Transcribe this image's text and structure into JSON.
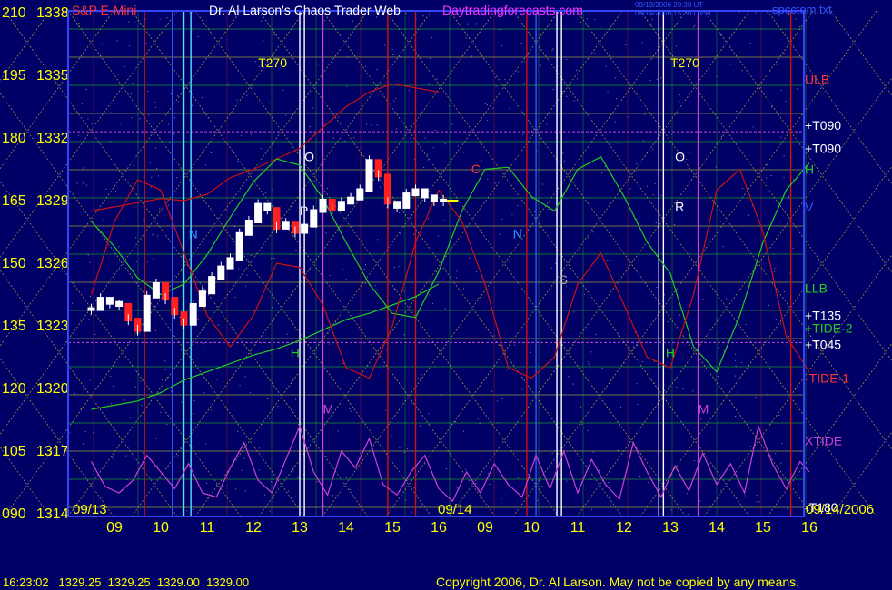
{
  "header": {
    "instrument": "S&P E-Mini",
    "title": "Dr. Al Larson's Chaos Trader Web",
    "site": "Daytradingforecasts.com",
    "stamp_line1": "09/13/2006 20:30 UT",
    "stamp_line2": "09/14/2006 15:30 Local",
    "filename": "spcctom.txt"
  },
  "footer": {
    "quote": "16:23:02   1329.25  1329.25  1329.00  1329.00",
    "copyright": "Copyright 2006, Dr. Al Larson. May not be copied by any means."
  },
  "colors": {
    "background": "#000066",
    "axis_text": "#ffff00",
    "price_bars": "#ffffff",
    "down_bars": "#ff2020",
    "green": "#22cc22",
    "red": "#cc1111",
    "magenta": "#cc44cc",
    "yellow_grid": "#cccc33"
  },
  "chart_data": {
    "type": "line",
    "title": "S&P E-Mini",
    "y_left_labels": [
      "210",
      "195",
      "180",
      "165",
      "150",
      "135",
      "120",
      "105",
      "090"
    ],
    "y_price_labels": [
      "1338",
      "1335",
      "1332",
      "1329",
      "1326",
      "1323",
      "1320",
      "1317",
      "1314"
    ],
    "ylim": [
      1314,
      1338
    ],
    "x_hour_labels": [
      "09",
      "10",
      "11",
      "12",
      "13",
      "14",
      "15",
      "16",
      "09",
      "10",
      "11",
      "12",
      "13",
      "14",
      "15",
      "16"
    ],
    "date_labels": [
      "09/13",
      "09/14",
      "09/14/2006"
    ],
    "right_labels": [
      {
        "text": "ULB",
        "color": "#ff3333",
        "price": 1334.8
      },
      {
        "text": "+T090",
        "color": "#ffffff",
        "price": 1332.6
      },
      {
        "text": "+T090",
        "color": "#ffffff",
        "price": 1331.5
      },
      {
        "text": "H",
        "color": "#22cc22",
        "price": 1330.5
      },
      {
        "text": "V",
        "color": "#3355ff",
        "price": 1328.7
      },
      {
        "text": "LLB",
        "color": "#22cc22",
        "price": 1324.8
      },
      {
        "text": "+T135",
        "color": "#ffffff",
        "price": 1323.5
      },
      {
        "text": "+TIDE-2",
        "color": "#22cc22",
        "price": 1322.9
      },
      {
        "text": "+T045",
        "color": "#ffffff",
        "price": 1322.1
      },
      {
        "text": "-TIDE-1",
        "color": "#ff3333",
        "price": 1320.5
      },
      {
        "text": "XTIDE",
        "color": "#cc44cc",
        "price": 1317.5
      },
      {
        "text": "-T180",
        "color": "#ffffff",
        "price": 1314.3
      }
    ],
    "cycle_labels": [
      {
        "text": "T270",
        "color": "#ffff00",
        "hour": 12.1,
        "price": 1335.4
      },
      {
        "text": "T270",
        "color": "#ffff00",
        "hour": 21.0,
        "price": 1335.4
      },
      {
        "text": "O",
        "color": "#ffffff",
        "hour": 13.1,
        "price": 1330.9
      },
      {
        "text": "O",
        "color": "#ffffff",
        "hour": 21.1,
        "price": 1330.9
      },
      {
        "text": "P",
        "color": "#ffffff",
        "hour": 13.0,
        "price": 1328.3
      },
      {
        "text": "R",
        "color": "#ffffff",
        "hour": 21.1,
        "price": 1328.5
      },
      {
        "text": "N",
        "color": "#3399ff",
        "hour": 10.6,
        "price": 1327.2
      },
      {
        "text": "N",
        "color": "#3399ff",
        "hour": 17.6,
        "price": 1327.2
      },
      {
        "text": "S",
        "color": "#aaaaaa",
        "hour": 18.6,
        "price": 1325.0
      },
      {
        "text": "H",
        "color": "#22cc22",
        "hour": 12.8,
        "price": 1321.5
      },
      {
        "text": "H",
        "color": "#22cc22",
        "hour": 20.9,
        "price": 1321.5
      },
      {
        "text": "M",
        "color": "#cc44cc",
        "hour": 13.5,
        "price": 1318.8
      },
      {
        "text": "M",
        "color": "#cc44cc",
        "hour": 21.6,
        "price": 1318.8
      },
      {
        "text": "C",
        "color": "#ff3333",
        "hour": 16.7,
        "price": 1330.3
      }
    ],
    "series": [
      {
        "name": "S&P E-Mini",
        "color": "#ffffff",
        "x": [
          8.5,
          8.7,
          8.9,
          9.1,
          9.3,
          9.5,
          9.7,
          9.9,
          10.1,
          10.3,
          10.5,
          10.7,
          10.9,
          11.1,
          11.3,
          11.5,
          11.7,
          11.9,
          12.1,
          12.3,
          12.5,
          12.7,
          12.9,
          13.1,
          13.3,
          13.5,
          13.7,
          13.9,
          14.1,
          14.3,
          14.5,
          14.7,
          14.9,
          15.1,
          15.3,
          15.5,
          15.7,
          15.9,
          16.1
        ],
        "y": [
          1323.8,
          1324.3,
          1324.1,
          1324.0,
          1323.3,
          1322.8,
          1324.4,
          1325.0,
          1324.3,
          1323.6,
          1323.1,
          1324.0,
          1324.6,
          1325.3,
          1325.8,
          1326.2,
          1327.4,
          1328.0,
          1328.8,
          1328.6,
          1327.7,
          1327.9,
          1327.5,
          1327.8,
          1328.5,
          1329.0,
          1328.6,
          1328.9,
          1329.1,
          1329.5,
          1330.9,
          1330.2,
          1328.9,
          1328.7,
          1329.3,
          1329.5,
          1329.2,
          1329.0,
          1329.0
        ]
      },
      {
        "name": "ULB",
        "color": "#cc1111",
        "x": [
          8.5,
          9.0,
          9.5,
          10.0,
          10.5,
          11.0,
          11.5,
          12.0,
          12.5,
          13.0,
          13.5,
          14.0,
          14.5,
          15.0,
          15.5,
          16.0
        ],
        "y": [
          1328.5,
          1328.7,
          1328.9,
          1329.1,
          1329.0,
          1329.3,
          1330.1,
          1330.5,
          1331.0,
          1331.5,
          1332.5,
          1333.5,
          1334.2,
          1334.6,
          1334.4,
          1334.2
        ]
      },
      {
        "name": "LLB",
        "color": "#22cc22",
        "x": [
          8.5,
          9.0,
          9.5,
          10.0,
          10.5,
          11.0,
          11.5,
          12.0,
          12.5,
          13.0,
          13.5,
          14.0,
          14.5,
          15.0,
          15.5,
          16.0
        ],
        "y": [
          1319.0,
          1319.2,
          1319.4,
          1319.8,
          1320.4,
          1320.8,
          1321.2,
          1321.6,
          1321.9,
          1322.3,
          1322.8,
          1323.3,
          1323.6,
          1324.0,
          1324.4,
          1325.0
        ]
      },
      {
        "name": "+TIDE-2",
        "color": "#22cc22",
        "x": [
          8.5,
          9.0,
          9.5,
          10.0,
          10.5,
          11.0,
          11.5,
          12.0,
          12.5,
          13.0,
          13.5,
          14.0,
          14.5,
          15.0,
          15.5,
          16.0,
          16.5,
          17.0,
          17.5,
          18.0,
          18.5,
          19.0,
          19.5,
          20.0,
          20.5,
          21.0,
          21.5,
          22.0,
          22.5,
          23.0,
          23.5,
          24.0
        ],
        "y": [
          1328.0,
          1326.8,
          1325.3,
          1324.5,
          1325.0,
          1326.4,
          1328.2,
          1329.9,
          1331.0,
          1330.7,
          1329.1,
          1327.0,
          1325.0,
          1323.6,
          1323.4,
          1325.6,
          1328.5,
          1330.5,
          1330.6,
          1329.2,
          1328.5,
          1330.5,
          1331.1,
          1329.2,
          1327.0,
          1325.5,
          1322.0,
          1320.8,
          1323.5,
          1327.0,
          1329.5,
          1330.8
        ]
      },
      {
        "name": "-TIDE-1",
        "color": "#cc1111",
        "x": [
          8.5,
          9.0,
          9.5,
          10.0,
          10.5,
          11.0,
          11.5,
          12.0,
          12.5,
          13.0,
          13.5,
          14.0,
          14.5,
          15.0,
          15.5,
          16.0,
          16.5,
          17.0,
          17.5,
          18.0,
          18.5,
          19.0,
          19.5,
          20.0,
          20.5,
          21.0,
          21.5,
          22.0,
          22.5,
          23.0,
          23.5,
          24.0
        ],
        "y": [
          1324.5,
          1328.0,
          1330.0,
          1329.5,
          1326.5,
          1323.5,
          1322.0,
          1323.5,
          1326.0,
          1325.8,
          1324.0,
          1321.0,
          1320.5,
          1323.0,
          1327.0,
          1329.5,
          1328.0,
          1325.0,
          1321.0,
          1320.5,
          1321.5,
          1325.0,
          1326.5,
          1324.0,
          1321.5,
          1321.0,
          1324.5,
          1329.5,
          1330.5,
          1327.5,
          1322.5,
          1320.8
        ]
      },
      {
        "name": "XTIDE",
        "color": "#cc44cc",
        "x": [
          8.5,
          8.8,
          9.1,
          9.4,
          9.7,
          10.0,
          10.3,
          10.6,
          10.9,
          11.2,
          11.5,
          11.8,
          12.1,
          12.4,
          12.7,
          13.0,
          13.3,
          13.6,
          13.9,
          14.2,
          14.5,
          14.8,
          15.1,
          15.4,
          15.7,
          16.0,
          16.3,
          16.6,
          16.9,
          17.2,
          17.5,
          17.8,
          18.1,
          18.4,
          18.7,
          19.0,
          19.3,
          19.6,
          19.9,
          20.2,
          20.5,
          20.8,
          21.1,
          21.4,
          21.7,
          22.0,
          22.3,
          22.6,
          22.9,
          23.2,
          23.5,
          23.8,
          24.0
        ],
        "y": [
          1316.5,
          1315.3,
          1315.0,
          1315.6,
          1316.8,
          1316.0,
          1315.2,
          1316.4,
          1315.0,
          1314.8,
          1316.2,
          1317.4,
          1315.6,
          1315.0,
          1316.6,
          1318.2,
          1316.0,
          1314.9,
          1317.0,
          1316.2,
          1317.6,
          1315.4,
          1314.9,
          1316.0,
          1316.8,
          1315.2,
          1314.6,
          1316.0,
          1315.0,
          1316.4,
          1315.4,
          1314.8,
          1316.8,
          1315.2,
          1317.0,
          1315.0,
          1316.6,
          1315.4,
          1314.7,
          1317.4,
          1316.0,
          1314.8,
          1316.3,
          1315.1,
          1316.9,
          1315.4,
          1316.4,
          1315.0,
          1318.2,
          1316.4,
          1315.2,
          1316.5,
          1316.0
        ]
      }
    ],
    "vertical_markers": [
      {
        "hour": 9.65,
        "color": "#cc1111"
      },
      {
        "hour": 10.25,
        "color": "#3355ff"
      },
      {
        "hour": 10.5,
        "color": "#55ddff"
      },
      {
        "hour": 10.65,
        "color": "#55ddff"
      },
      {
        "hour": 13.0,
        "color": "#ffffff"
      },
      {
        "hour": 13.1,
        "color": "#ffffff"
      },
      {
        "hour": 13.5,
        "color": "#cc44cc"
      },
      {
        "hour": 14.9,
        "color": "#cc1111"
      },
      {
        "hour": 15.5,
        "color": "#cc1111"
      },
      {
        "hour": 17.9,
        "color": "#cc1111"
      },
      {
        "hour": 18.1,
        "color": "#3355ff"
      },
      {
        "hour": 18.55,
        "color": "#ffffff"
      },
      {
        "hour": 18.65,
        "color": "#ffffff"
      },
      {
        "hour": 20.75,
        "color": "#ffffff"
      },
      {
        "hour": 20.85,
        "color": "#ffffff"
      },
      {
        "hour": 21.6,
        "color": "#cc44cc"
      },
      {
        "hour": 23.6,
        "color": "#cc1111"
      }
    ]
  }
}
